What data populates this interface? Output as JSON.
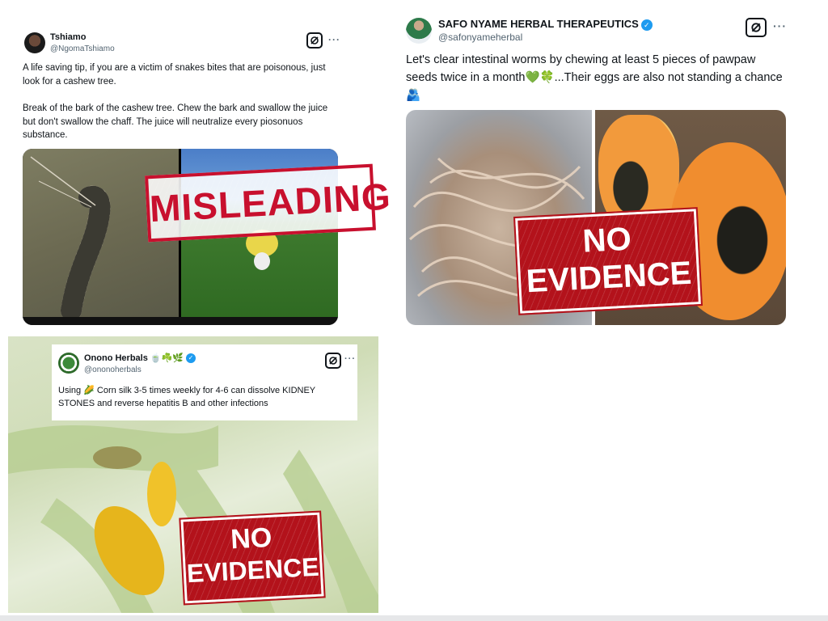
{
  "posts": {
    "tshiamo": {
      "display_name": "Tshiamo",
      "handle": "@NgomaTshiamo",
      "text_p1": "A life saving tip, if you are a victim of snakes bites that are poisonous, just look for a cashew tree.",
      "text_p2": "Break of the bark of the cashew tree. Chew the bark and swallow the juice but don't  swallow the chaff. The juice will neutralize every piosonuos substance.",
      "stamp": "MISLEADING",
      "more": "···"
    },
    "safo": {
      "display_name": "SAFO NYAME HERBAL THERAPEUTICS",
      "handle": "@safonyameherbal",
      "text": "Let's clear intestinal worms by chewing at least 5 pieces of pawpaw seeds twice in a month💚🍀...Their eggs are also not standing a chance 🫂",
      "stamp_line1": "NO",
      "stamp_line2": "EVIDENCE",
      "more": "···"
    },
    "onono": {
      "display_name": "Onono Herbals 🍵☘️🌿",
      "handle": "@ononoherbals",
      "text": "Using 🌽 Corn silk 3-5 times weekly for 4-6  can dissolve KIDNEY STONES and reverse hepatitis B and other infections",
      "stamp_line1": "NO",
      "stamp_line2": "EVIDENCE",
      "more": "···"
    }
  },
  "colors": {
    "verified_blue": "#1d9bf0",
    "stamp_red": "#c8102e",
    "handle_gray": "#536471"
  },
  "icons": {
    "grok": "grok-icon",
    "more": "more-icon",
    "verified": "verified-badge-icon"
  }
}
